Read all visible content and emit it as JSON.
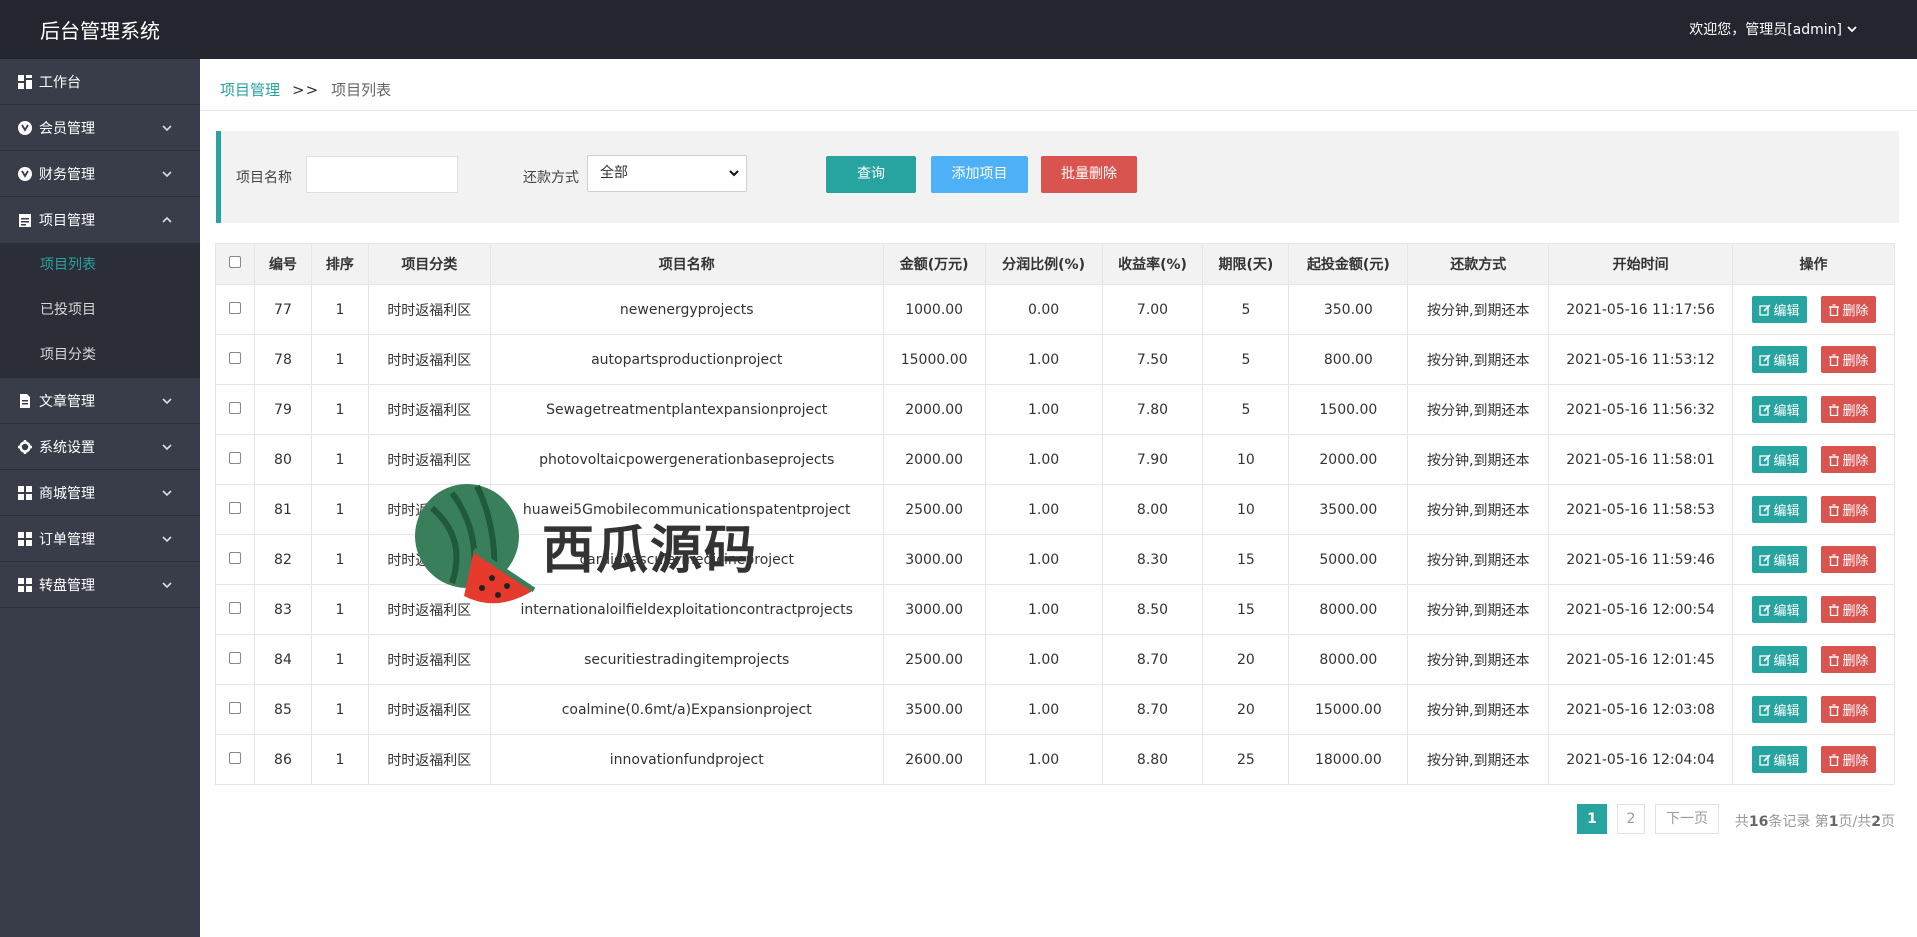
{
  "header": {
    "title": "后台管理系统",
    "user_label": "欢迎您，管理员[admin]"
  },
  "sidebar": {
    "items": [
      {
        "label": "工作台",
        "icon": "dashboard-icon"
      },
      {
        "label": "会员管理",
        "icon": "member-icon"
      },
      {
        "label": "财务管理",
        "icon": "finance-icon"
      },
      {
        "label": "项目管理",
        "icon": "clipboard-icon",
        "open": true
      },
      {
        "label": "文章管理",
        "icon": "document-icon"
      },
      {
        "label": "系统设置",
        "icon": "gear-icon"
      },
      {
        "label": "商城管理",
        "icon": "grid-icon"
      },
      {
        "label": "订单管理",
        "icon": "grid-icon"
      },
      {
        "label": "转盘管理",
        "icon": "grid-icon"
      }
    ],
    "project_sub": [
      "项目列表",
      "已投项目",
      "项目分类"
    ]
  },
  "breadcrumb": {
    "parent": "项目管理",
    "separator": ">>",
    "current": "项目列表"
  },
  "search": {
    "name_label": "项目名称",
    "name_value": "",
    "repay_label": "还款方式",
    "repay_selected": "全部",
    "query_button": "查询",
    "add_button": "添加项目",
    "batch_delete_button": "批量删除"
  },
  "table": {
    "headers": [
      "编号",
      "排序",
      "项目分类",
      "项目名称",
      "金额(万元)",
      "分润比例(%)",
      "收益率(%)",
      "期限(天)",
      "起投金额(元)",
      "还款方式",
      "开始时间",
      "操作"
    ],
    "edit_label": "编辑",
    "delete_label": "删除",
    "rows": [
      [
        "77",
        "1",
        "时时返福利区",
        "newenergyprojects",
        "1000.00",
        "0.00",
        "7.00",
        "5",
        "350.00",
        "按分钟,到期还本",
        "2021-05-16 11:17:56"
      ],
      [
        "78",
        "1",
        "时时返福利区",
        "autopartsproductionproject",
        "15000.00",
        "1.00",
        "7.50",
        "5",
        "800.00",
        "按分钟,到期还本",
        "2021-05-16 11:53:12"
      ],
      [
        "79",
        "1",
        "时时返福利区",
        "Sewagetreatmentplantexpansionproject",
        "2000.00",
        "1.00",
        "7.80",
        "5",
        "1500.00",
        "按分钟,到期还本",
        "2021-05-16 11:56:32"
      ],
      [
        "80",
        "1",
        "时时返福利区",
        "photovoltaicpowergenerationbaseprojects",
        "2000.00",
        "1.00",
        "7.90",
        "10",
        "2000.00",
        "按分钟,到期还本",
        "2021-05-16 11:58:01"
      ],
      [
        "81",
        "1",
        "时时返福利区",
        "huawei5Gmobilecommunicationspatentproject",
        "2500.00",
        "1.00",
        "8.00",
        "10",
        "3500.00",
        "按分钟,到期还本",
        "2021-05-16 11:58:53"
      ],
      [
        "82",
        "1",
        "时时返福利区",
        "cardiovascularmedicineproject",
        "3000.00",
        "1.00",
        "8.30",
        "15",
        "5000.00",
        "按分钟,到期还本",
        "2021-05-16 11:59:46"
      ],
      [
        "83",
        "1",
        "时时返福利区",
        "internationaloilfieldexploitationcontractprojects",
        "3000.00",
        "1.00",
        "8.50",
        "15",
        "8000.00",
        "按分钟,到期还本",
        "2021-05-16 12:00:54"
      ],
      [
        "84",
        "1",
        "时时返福利区",
        "securitiestradingitemprojects",
        "2500.00",
        "1.00",
        "8.70",
        "20",
        "8000.00",
        "按分钟,到期还本",
        "2021-05-16 12:01:45"
      ],
      [
        "85",
        "1",
        "时时返福利区",
        "coalmine(0.6mt/a)Expansionproject",
        "3500.00",
        "1.00",
        "8.70",
        "20",
        "15000.00",
        "按分钟,到期还本",
        "2021-05-16 12:03:08"
      ],
      [
        "86",
        "1",
        "时时返福利区",
        "innovationfundproject",
        "2600.00",
        "1.00",
        "8.80",
        "25",
        "18000.00",
        "按分钟,到期还本",
        "2021-05-16 12:04:04"
      ]
    ]
  },
  "pager": {
    "page1": "1",
    "page2": "2",
    "next": "下一页",
    "info_prefix": "共",
    "total": "16",
    "info_mid": "条记录 第",
    "current": "1",
    "info_mid2": "页/共",
    "pages": "2",
    "info_suffix": "页"
  },
  "watermark": {
    "text": "西瓜源码"
  },
  "colors": {
    "topbar": "#23262e",
    "sidebar": "#393d49",
    "accent": "#27a3a0",
    "blue": "#4eb1f8",
    "danger": "#d9534f"
  }
}
